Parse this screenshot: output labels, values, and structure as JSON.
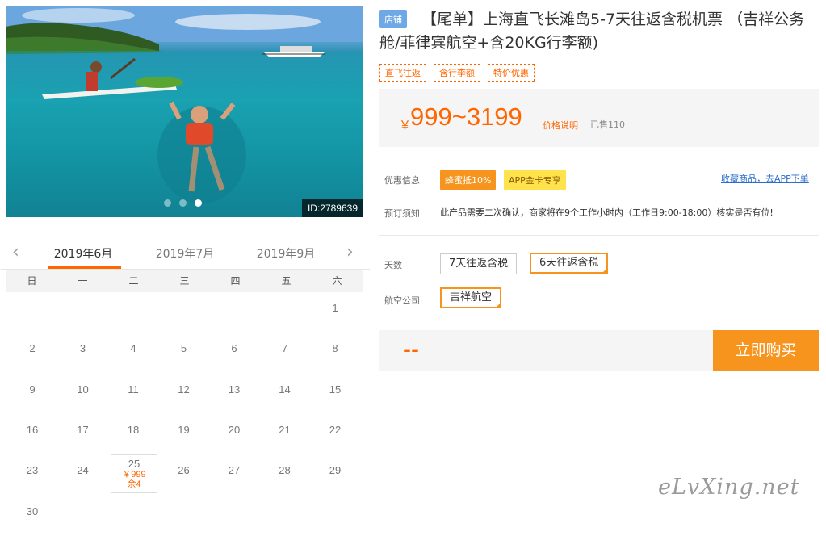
{
  "photo": {
    "id_label": "ID:2789639",
    "slides": 3,
    "active_slide": 3
  },
  "calendar": {
    "prev_icon": "chevron-left-icon",
    "next_icon": "chevron-right-icon",
    "months": [
      "2019年6月",
      "2019年7月",
      "2019年9月"
    ],
    "active_month": "2019年6月",
    "weekdays": [
      "日",
      "一",
      "二",
      "三",
      "四",
      "五",
      "六"
    ],
    "days": [
      "1",
      "2",
      "3",
      "4",
      "5",
      "6",
      "7",
      "8",
      "9",
      "10",
      "11",
      "12",
      "13",
      "14",
      "15",
      "16",
      "17",
      "18",
      "19",
      "20",
      "21",
      "22",
      "23",
      "24",
      "25",
      "26",
      "27",
      "28",
      "29",
      "30"
    ],
    "selected": {
      "day": "25",
      "price": "￥999",
      "stock": "余4"
    }
  },
  "product": {
    "badge": "店铺",
    "title": "【尾单】上海直飞长滩岛5-7天往返含税机票 （吉祥公务舱/菲律宾航空+含20KG行李额)",
    "tags": [
      "直飞往返",
      "含行李额",
      "特价优惠"
    ],
    "price_symbol": "￥",
    "price_range": "999~3199",
    "price_explain": "价格说明",
    "sold": "已售110"
  },
  "discount": {
    "label": "优惠信息",
    "badge1": "蜂蜜抵10%",
    "badge2": "APP金卡专享",
    "favorite": "收藏商品，去APP下单"
  },
  "booking": {
    "label": "预订须知",
    "text": "此产品需要二次确认，商家将在9个工作小时内（工作日9:00-18:00）核实是否有位!"
  },
  "options": {
    "days_label": "天数",
    "days": [
      "7天往返含税",
      "6天往返含税"
    ],
    "days_selected": "6天往返含税",
    "airline_label": "航空公司",
    "airline": "吉祥航空"
  },
  "buy": {
    "price": "--",
    "button": "立即购买"
  },
  "watermark": "eLvXing.net",
  "colors": {
    "accent": "#f7941d",
    "price": "#ff6600",
    "badge_blue": "#6fa8e7"
  }
}
